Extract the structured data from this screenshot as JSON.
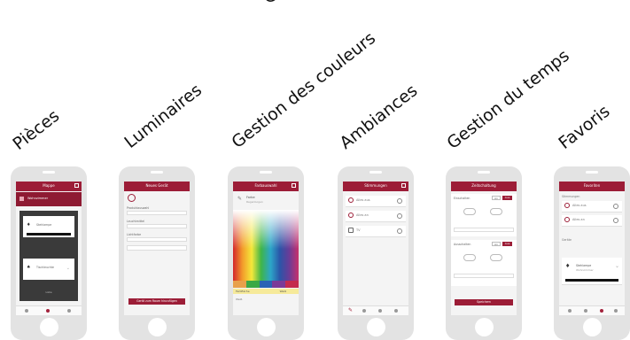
{
  "labels": {
    "top": "Gestion des couleurs",
    "rooms": "Pièces",
    "lights": "Luminaires",
    "colors": "Gestion des couleurs",
    "moods": "Ambiances",
    "time": "Gestion du temps",
    "favorites": "Favoris"
  },
  "colors": {
    "accent": "#9c1d37",
    "phone_body": "#e3e3e3",
    "screen_bg": "#f4f4f4"
  },
  "phones": {
    "rooms": {
      "title": "Mappe",
      "list_item": "Wohnzimmer",
      "card1": "Stehlampe",
      "card2": "Tischleuchte",
      "footer": "Liste"
    },
    "lights": {
      "title": "Neues Gerät",
      "field1": "Produktauswahl",
      "field2": "Leuchtmittel",
      "field3": "Lichtfarbe",
      "button": "Gerät zum Raum hinzufügen"
    },
    "colors": {
      "title": "Farbauswahl",
      "name": "Farbe",
      "sub": "Regenbogen",
      "tab1": "Farbfläche",
      "tab2": "Weiß",
      "footer": "Weiß"
    },
    "moods": {
      "title": "Stimmungen",
      "items": [
        "Alles aus",
        "Alles an",
        "TV"
      ]
    },
    "time": {
      "title": "Zeitschaltung",
      "row1": "Einschalten",
      "row2": "Ausschalten",
      "on": "An",
      "off": "Aus",
      "button": "Speichern"
    },
    "favorites": {
      "title": "Favoriten",
      "group1": "Stimmungen",
      "items": [
        "Alles aus",
        "Alles an"
      ],
      "group2": "Geräte",
      "device": "Stehlampe",
      "device_sub": "Wohnzimmer"
    }
  }
}
